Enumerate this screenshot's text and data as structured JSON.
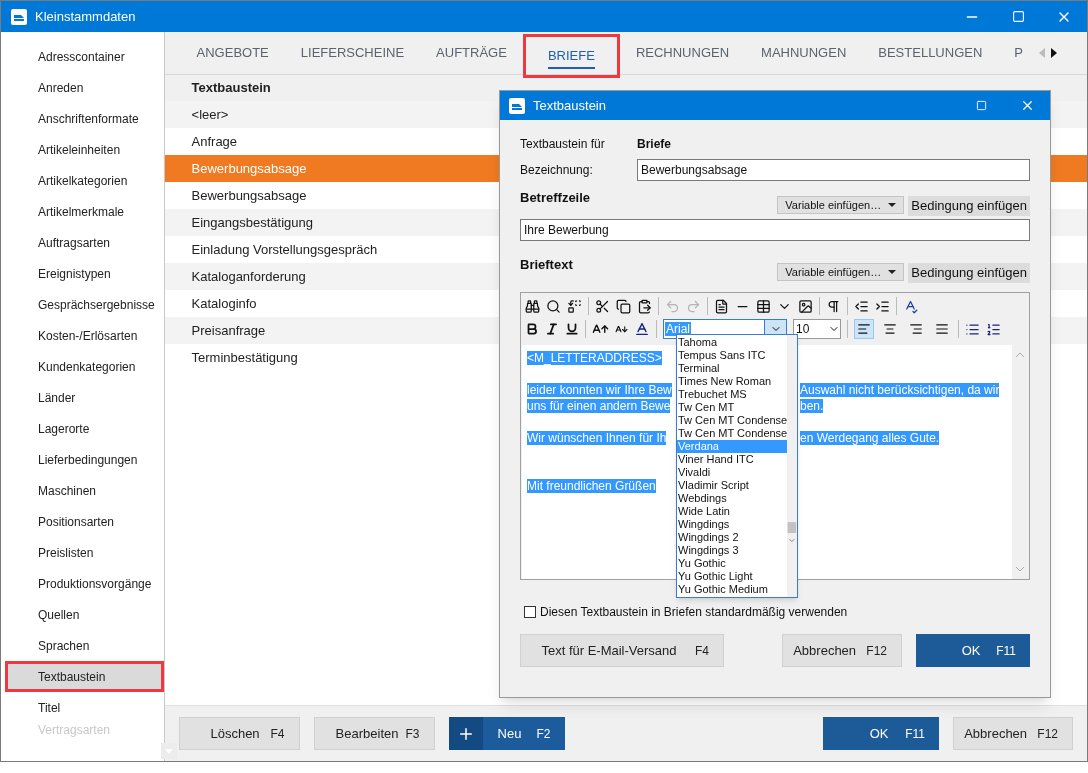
{
  "window": {
    "title": "Kleinstammdaten"
  },
  "sidebar": {
    "items": [
      {
        "label": "Adresscontainer",
        "selected": false,
        "faded": false
      },
      {
        "label": "Anreden",
        "selected": false,
        "faded": false
      },
      {
        "label": "Anschriftenformate",
        "selected": false,
        "faded": false
      },
      {
        "label": "Artikeleinheiten",
        "selected": false,
        "faded": false
      },
      {
        "label": "Artikelkategorien",
        "selected": false,
        "faded": false
      },
      {
        "label": "Artikelmerkmale",
        "selected": false,
        "faded": false
      },
      {
        "label": "Auftragsarten",
        "selected": false,
        "faded": false
      },
      {
        "label": "Ereignistypen",
        "selected": false,
        "faded": false
      },
      {
        "label": "Gesprächsergebnisse",
        "selected": false,
        "faded": false
      },
      {
        "label": "Kosten-/Erlösarten",
        "selected": false,
        "faded": false
      },
      {
        "label": "Kundenkategorien",
        "selected": false,
        "faded": false
      },
      {
        "label": "Länder",
        "selected": false,
        "faded": false
      },
      {
        "label": "Lagerorte",
        "selected": false,
        "faded": false
      },
      {
        "label": "Lieferbedingungen",
        "selected": false,
        "faded": false
      },
      {
        "label": "Maschinen",
        "selected": false,
        "faded": false
      },
      {
        "label": "Positionsarten",
        "selected": false,
        "faded": false
      },
      {
        "label": "Preislisten",
        "selected": false,
        "faded": false
      },
      {
        "label": "Produktionsvorgänge",
        "selected": false,
        "faded": false
      },
      {
        "label": "Quellen",
        "selected": false,
        "faded": false
      },
      {
        "label": "Sprachen",
        "selected": false,
        "faded": false
      },
      {
        "label": "Textbaustein",
        "selected": true,
        "faded": false
      },
      {
        "label": "Titel",
        "selected": false,
        "faded": false
      },
      {
        "label": "Vertragsarten",
        "selected": false,
        "faded": true
      }
    ]
  },
  "tabs": [
    {
      "label": "ANGEBOTE",
      "selected": false
    },
    {
      "label": "LIEFERSCHEINE",
      "selected": false
    },
    {
      "label": "AUFTRÄGE",
      "selected": false
    },
    {
      "label": "BRIEFE",
      "selected": true
    },
    {
      "label": "RECHNUNGEN",
      "selected": false
    },
    {
      "label": "MAHNUNGEN",
      "selected": false
    },
    {
      "label": "BESTELLUNGEN",
      "selected": false
    },
    {
      "label": "P",
      "selected": false
    }
  ],
  "table": {
    "columns": [
      "Textbaustein"
    ],
    "rows": [
      {
        "cells": [
          "<leer>"
        ],
        "selected": false
      },
      {
        "cells": [
          "Anfrage"
        ],
        "selected": false
      },
      {
        "cells": [
          "Bewerbungsabsage"
        ],
        "selected": true
      },
      {
        "cells": [
          "Bewerbungsabsage"
        ],
        "selected": false
      },
      {
        "cells": [
          "Eingangsbestätigung"
        ],
        "selected": false
      },
      {
        "cells": [
          "Einladung Vorstellungsgespräch"
        ],
        "selected": false
      },
      {
        "cells": [
          "Kataloganforderung"
        ],
        "selected": false
      },
      {
        "cells": [
          "Kataloginfo"
        ],
        "selected": false
      },
      {
        "cells": [
          "Preisanfrage"
        ],
        "selected": false
      },
      {
        "cells": [
          "Terminbestätigung"
        ],
        "selected": false
      }
    ]
  },
  "bottom_buttons": [
    {
      "label": "Löschen",
      "key": "F4",
      "kind": "plain"
    },
    {
      "label": "Bearbeiten",
      "key": "F3",
      "kind": "plain"
    },
    {
      "label": "Neu",
      "key": "F2",
      "kind": "add"
    },
    {
      "label": "OK",
      "key": "F11",
      "kind": "primary"
    },
    {
      "label": "Abbrechen",
      "key": "F12",
      "kind": "plain"
    }
  ],
  "dialog": {
    "title": "Textbaustein",
    "for_label": "Textbaustein für",
    "for_value": "Briefe",
    "name_label": "Bezeichnung:",
    "name_value": "Bewerbungsabsage",
    "subject_heading": "Betreffzeile",
    "subject_variable": "Variable einfügen…",
    "subject_condition": "Bedingung einfügen",
    "subject_value": "Ihre Bewerbung",
    "body_heading": "Brieftext",
    "body_variable": "Variable einfügen…",
    "body_condition": "Bedingung einfügen",
    "toolbar": {
      "history_buttons": [
        {
          "disabled": true
        },
        {
          "disabled": true
        }
      ],
      "align_buttons": [
        {
          "selected": true
        },
        {
          "selected": false
        },
        {
          "selected": false
        },
        {
          "selected": false
        }
      ],
      "font": "Arial",
      "size": "10"
    },
    "font_list": [
      {
        "label": "Tahoma",
        "selected": false
      },
      {
        "label": "Tempus Sans ITC",
        "selected": false
      },
      {
        "label": "Terminal",
        "selected": false
      },
      {
        "label": "Times New Roman",
        "selected": false
      },
      {
        "label": "Trebuchet MS",
        "selected": false
      },
      {
        "label": "Tw Cen MT",
        "selected": false
      },
      {
        "label": "Tw Cen MT Condense",
        "selected": false
      },
      {
        "label": "Tw Cen MT Condense",
        "selected": false
      },
      {
        "label": "Verdana",
        "selected": true
      },
      {
        "label": "Viner Hand ITC",
        "selected": false
      },
      {
        "label": "Vivaldi",
        "selected": false
      },
      {
        "label": "Vladimir Script",
        "selected": false
      },
      {
        "label": "Webdings",
        "selected": false
      },
      {
        "label": "Wide Latin",
        "selected": false
      },
      {
        "label": "Wingdings",
        "selected": false
      },
      {
        "label": "Wingdings 2",
        "selected": false
      },
      {
        "label": "Wingdings 3",
        "selected": false
      },
      {
        "label": "Yu Gothic",
        "selected": false
      },
      {
        "label": "Yu Gothic Light",
        "selected": false
      },
      {
        "label": "Yu Gothic Medium",
        "selected": false
      }
    ],
    "lines": [
      {
        "kind": "text",
        "left": "<M_LETTERADDRESS>"
      },
      {
        "kind": "blank"
      },
      {
        "kind": "text",
        "left": "leider konnten wir Ihre Bew",
        "right": "Auswahl nicht berücksichtigen, da wir"
      },
      {
        "kind": "text",
        "left": "uns für einen andern Bewe",
        "right": "ben."
      },
      {
        "kind": "blank"
      },
      {
        "kind": "text",
        "left": "Wir wünschen Ihnen für Ih",
        "right": "en Werdegang alles Gute."
      },
      {
        "kind": "blank"
      },
      {
        "kind": "blank"
      },
      {
        "kind": "text",
        "left": "Mit freundlichen Grüßen"
      }
    ],
    "default_checkbox": {
      "label": "Diesen Textbaustein in Briefen standardmäßig verwenden",
      "checked": false
    },
    "buttons": [
      {
        "label": "Text für E-Mail-Versand",
        "key": "F4",
        "kind": "plain"
      },
      {
        "label": "Abbrechen",
        "key": "F12",
        "kind": "plain"
      },
      {
        "label": "OK",
        "key": "F11",
        "kind": "primary"
      }
    ]
  }
}
